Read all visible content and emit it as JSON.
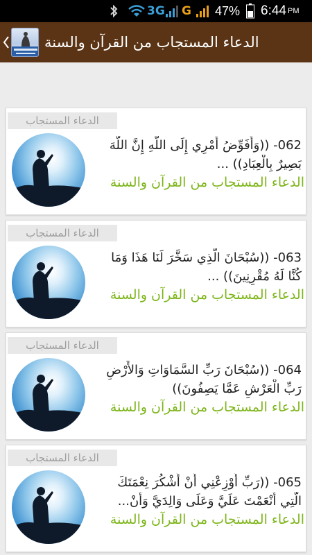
{
  "status_bar": {
    "network_3g": "3G",
    "network_g": "G",
    "battery_percent": "47%",
    "time": "6:44",
    "time_suffix": "PM",
    "icons": [
      "bluetooth-icon",
      "wifi-icon",
      "signal-icon",
      "signal-icon",
      "battery-icon"
    ]
  },
  "action_bar": {
    "title": "الدعاء المستجاب من القرآن والسنة",
    "back_icon": "chevron-left-icon",
    "logo_icon": "app-logo"
  },
  "colors": {
    "action_bar": "#5a3415",
    "subtitle_green": "#7cb518",
    "tag_bg": "#e8e8e8"
  },
  "cards": [
    {
      "tag": "الدعاء المستجاب",
      "number": "062",
      "line1": "062- ((وَأُفَوِّضُ أَمْرِي إِلَى اللَّهِ إِنَّ اللَّهَ",
      "line2": "بَصِيرٌ بِالْعِبَادِ)) ...",
      "subtitle": "الدعاء المستجاب من القرآن والسنة"
    },
    {
      "tag": "الدعاء المستجاب",
      "number": "063",
      "line1": "063- ((سُبْحَانَ الَّذِي سَخَّرَ لَنَا هَذَا وَمَا",
      "line2": "كُنَّا لَهُ مُقْرِنِينَ)) ...",
      "subtitle": "الدعاء المستجاب من القرآن والسنة"
    },
    {
      "tag": "الدعاء المستجاب",
      "number": "064",
      "line1": "064- ((سُبْحَانَ رَبِّ السَّمَاوَاتِ وَالأَرْضِ",
      "line2": "رَبِّ الْعَرْشِ عَمَّا يَصِفُونَ))",
      "subtitle": "الدعاء المستجاب من القرآن والسنة"
    },
    {
      "tag": "الدعاء المستجاب",
      "number": "065",
      "line1": "065- ((رَبِّ أَوْزِعْنِي أَنْ أَشْكُرَ نِعْمَتَكَ",
      "line2": "الَّتِي أَنْعَمْتَ عَلَيَّ وَعَلَى وَالِدَيَّ وَأَنْ...",
      "subtitle": "الدعاء المستجاب من القرآن والسنة"
    }
  ]
}
